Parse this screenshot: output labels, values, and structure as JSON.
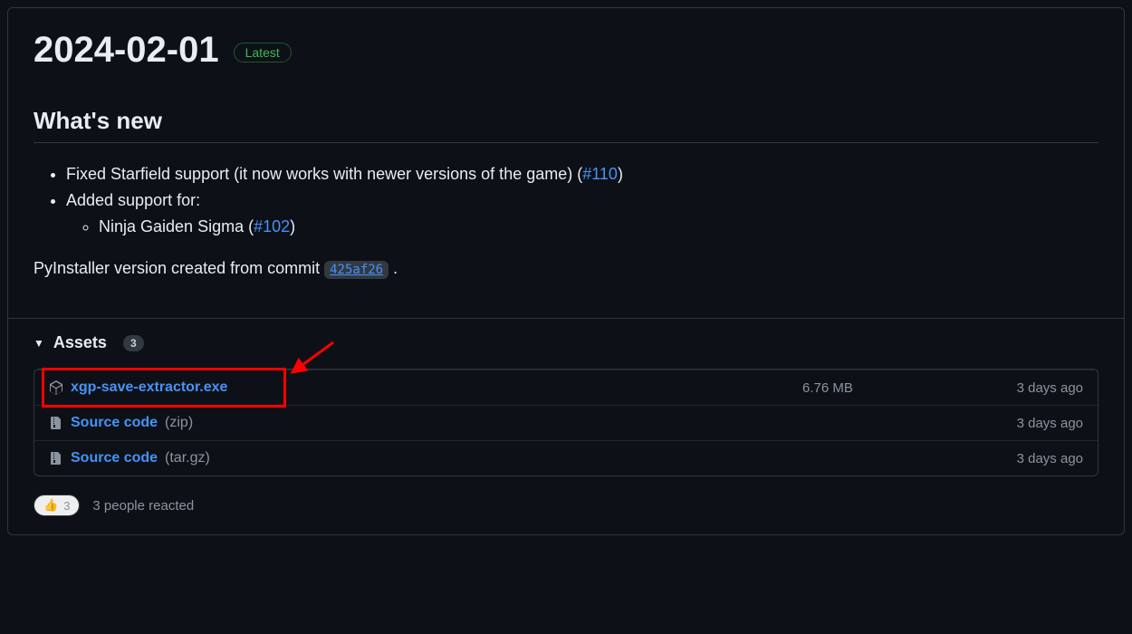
{
  "release": {
    "title": "2024-02-01",
    "badge": "Latest"
  },
  "changelog": {
    "heading": "What's new",
    "item1_prefix": "Fixed Starfield support (it now works with newer versions of the game) (",
    "item1_link": "#110",
    "item1_suffix": ")",
    "item2": "Added support for:",
    "item2_sub1_prefix": "Ninja Gaiden Sigma (",
    "item2_sub1_link": "#102",
    "item2_sub1_suffix": ")",
    "pyinstaller_prefix": "PyInstaller version created from commit ",
    "commit": "425af26",
    "pyinstaller_suffix": " ."
  },
  "assets": {
    "label": "Assets",
    "count": "3",
    "items": [
      {
        "name": "xgp-save-extractor.exe",
        "suffix": "",
        "size": "6.76 MB",
        "time": "3 days ago"
      },
      {
        "name": "Source code",
        "suffix": "(zip)",
        "size": "",
        "time": "3 days ago"
      },
      {
        "name": "Source code",
        "suffix": "(tar.gz)",
        "size": "",
        "time": "3 days ago"
      }
    ]
  },
  "reactions": {
    "emoji": "👍",
    "count": "3",
    "text": "3 people reacted"
  }
}
